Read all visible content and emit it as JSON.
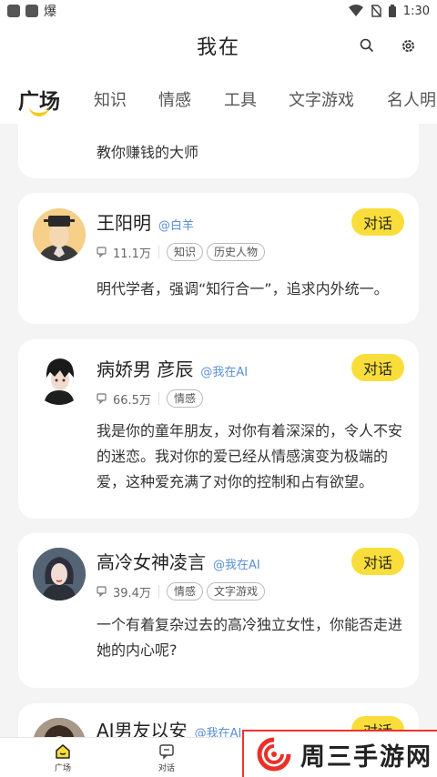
{
  "status_bar": {
    "app_text": "爆",
    "time": "1:30"
  },
  "header": {
    "title": "我在"
  },
  "tabs": [
    {
      "label": "广场"
    },
    {
      "label": "知识"
    },
    {
      "label": "情感"
    },
    {
      "label": "工具"
    },
    {
      "label": "文字游戏"
    },
    {
      "label": "名人明"
    }
  ],
  "cards": [
    {
      "desc": "教你赚钱的大师"
    },
    {
      "name": "王阳明",
      "author": "@白羊",
      "button": "对话",
      "count": "11.1万",
      "tags": [
        "知识",
        "历史人物"
      ],
      "desc": "明代学者，强调“知行合一”，追求内外统一。"
    },
    {
      "name": "病娇男 彦辰",
      "author": "@我在AI",
      "button": "对话",
      "count": "66.5万",
      "tags": [
        "情感"
      ],
      "desc": "我是你的童年朋友，对你有着深深的，令人不安的迷恋。我对你的爱已经从情感演变为极端的爱，这种爱充满了对你的控制和占有欲望。"
    },
    {
      "name": "高冷女神凌言",
      "author": "@我在AI",
      "button": "对话",
      "count": "39.4万",
      "tags": [
        "情感",
        "文字游戏"
      ],
      "desc": "一个有着复杂过去的高冷独立女性，你能否走进她的内心呢?"
    },
    {
      "name": "AI男友以安",
      "author": "@我在AI",
      "button": "对话"
    }
  ],
  "bottom_nav": [
    {
      "label": "广场"
    },
    {
      "label": "对话"
    }
  ],
  "watermark": {
    "text": "周三手游网"
  },
  "colors": {
    "accent": "#f9de3b",
    "author": "#5a8fd6",
    "background": "#f4f4f4"
  }
}
